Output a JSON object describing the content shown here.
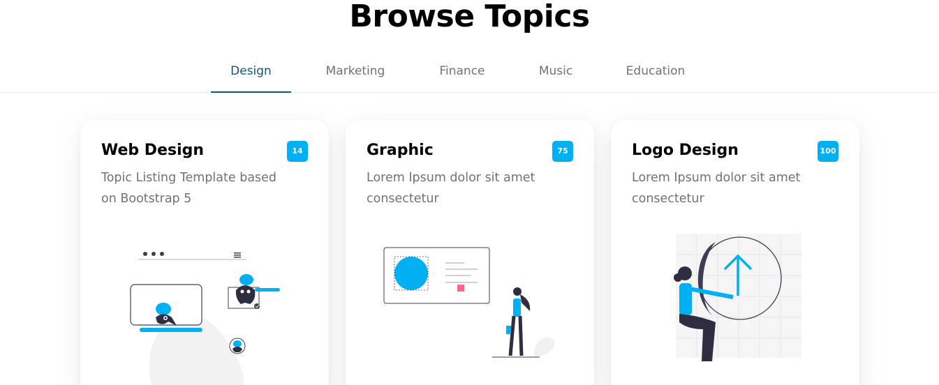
{
  "heading": "Browse Topics",
  "tabs": [
    {
      "label": "Design",
      "active": true
    },
    {
      "label": "Marketing",
      "active": false
    },
    {
      "label": "Finance",
      "active": false
    },
    {
      "label": "Music",
      "active": false
    },
    {
      "label": "Education",
      "active": false
    }
  ],
  "cards": [
    {
      "title": "Web Design",
      "description": "Topic Listing Template based on Bootstrap 5",
      "badge": "14"
    },
    {
      "title": "Graphic",
      "description": "Lorem Ipsum dolor sit amet consectetur",
      "badge": "75"
    },
    {
      "title": "Logo Design",
      "description": "Lorem Ipsum dolor sit amet consectetur",
      "badge": "100"
    }
  ],
  "colors": {
    "accent": "#00b0f2",
    "active_tab": "#13547a",
    "muted_text": "#717275"
  }
}
